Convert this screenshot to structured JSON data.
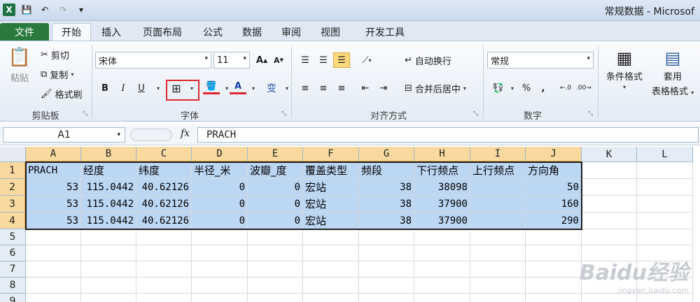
{
  "window": {
    "title": "常规数据 - Microsof"
  },
  "tabs": [
    "文件",
    "开始",
    "插入",
    "页面布局",
    "公式",
    "数据",
    "审阅",
    "视图",
    "开发工具"
  ],
  "clipboard": {
    "paste": "粘贴",
    "cut": "剪切",
    "copy": "复制",
    "format_painter": "格式刷",
    "label": "剪贴板"
  },
  "font": {
    "name": "宋体",
    "size": "11",
    "bold": "B",
    "italic": "I",
    "underline": "U",
    "label": "字体"
  },
  "alignment": {
    "wrap": "自动换行",
    "merge": "合并后居中",
    "label": "对齐方式"
  },
  "number": {
    "format": "常规",
    "percent": "%",
    "comma": ",",
    "label": "数字"
  },
  "styles": {
    "conditional": "条件格式",
    "table_line1": "套用",
    "table_line2": "表格格式"
  },
  "formula_bar": {
    "name_box": "A1",
    "fx": "fx",
    "value": "PRACH"
  },
  "columns": [
    "A",
    "B",
    "C",
    "D",
    "E",
    "F",
    "G",
    "H",
    "I",
    "J",
    "K",
    "L"
  ],
  "rows": [
    "1",
    "2",
    "3",
    "4",
    "5",
    "6",
    "7",
    "8",
    "9"
  ],
  "table": {
    "header": [
      "PRACH",
      "经度",
      "纬度",
      "半径_米",
      "波瓣_度",
      "覆盖类型",
      "频段",
      "下行频点",
      "上行频点",
      "方向角"
    ],
    "rows": [
      [
        "53",
        "115.0442",
        "40.62126",
        "0",
        "0",
        "宏站",
        "38",
        "38098",
        "",
        "50"
      ],
      [
        "53",
        "115.0442",
        "40.62126",
        "0",
        "0",
        "宏站",
        "38",
        "37900",
        "",
        "160"
      ],
      [
        "53",
        "115.0442",
        "40.62126",
        "0",
        "0",
        "宏站",
        "38",
        "37900",
        "",
        "290"
      ]
    ]
  },
  "watermark": {
    "brand": "Baidu经验",
    "url": "jingyan.baidu.com"
  },
  "colors": {
    "file_tab": "#2a7a3e",
    "selection": "#bcd7f4",
    "header_selected": "#f9d99f",
    "highlight": "#e0262b"
  }
}
